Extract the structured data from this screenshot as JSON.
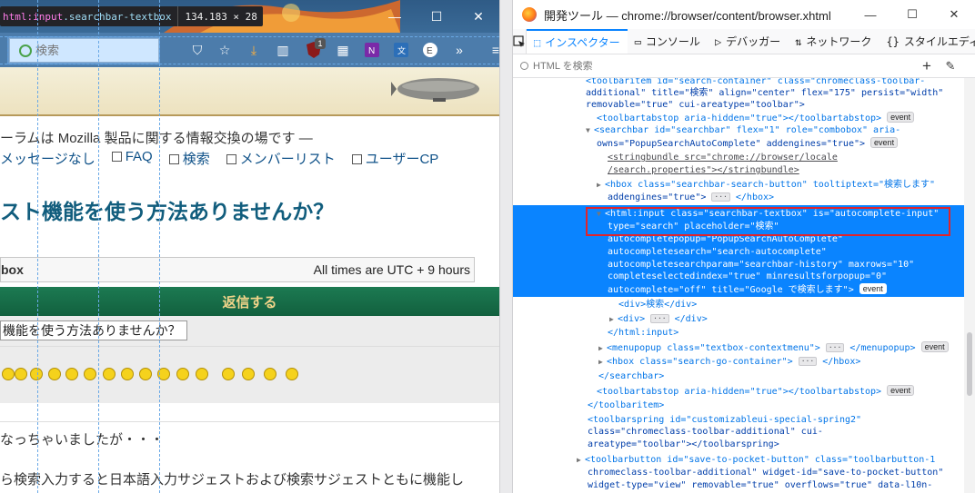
{
  "browser": {
    "picker_tooltip": {
      "tag": "html:input",
      "class_part": ".searchbar-textbox",
      "dimensions": "134.183 × 28"
    },
    "search_placeholder": "検索",
    "toolbar_badge": "1",
    "window_controls": [
      "—",
      "☐",
      "✕"
    ]
  },
  "page": {
    "forum_description": "ーラムは Mozilla 製品に関する情報交換の場です —",
    "nav_links": [
      "メッセージなし",
      "FAQ",
      "検索",
      "メンバーリスト",
      "ユーザーCP"
    ],
    "topic_title": "スト機能を使う方法ありませんか？",
    "tz_left": "box",
    "tz_right": "All times are UTC + 9 hours",
    "reply_heading": "返信する",
    "subject_value": "機能を使う方法ありませんか？",
    "body_line_1": "なっちゃいましたが・・・",
    "body_line_2": "ら検索入力すると日本語入力サジェストおよび検索サジェストともに機能し"
  },
  "devtools": {
    "window_title": "開発ツール — chrome://browser/content/browser.xhtml",
    "tabs": [
      {
        "label": "インスペクター",
        "icon": "inspector-icon"
      },
      {
        "label": "コンソール",
        "icon": "console-icon"
      },
      {
        "label": "デバッガー",
        "icon": "debugger-icon"
      },
      {
        "label": "ネットワーク",
        "icon": "network-icon"
      },
      {
        "label": "スタイルエディター",
        "icon": "style-editor-icon"
      }
    ],
    "search_placeholder": "HTML を検索",
    "event_badge": "event",
    "markup_lines": [
      "<toolbaritem id=\"search-container\" class=\"chromeclass-toolbar-",
      "additional\" title=\"検索\" align=\"center\" flex=\"175\" persist=\"width\"",
      "removable=\"true\" cui-areatype=\"toolbar\">",
      "<toolbartabstop aria-hidden=\"true\"></toolbartabstop>",
      "<searchbar id=\"searchbar\" flex=\"1\" role=\"combobox\" aria-",
      "owns=\"PopupSearchAutoComplete\" addengines=\"true\">",
      "<stringbundle src=\"chrome://browser/locale",
      "/search.properties\"></stringbundle>",
      "<hbox class=\"searchbar-search-button\" tooltiptext=\"検索します\"",
      "addengines=\"true\">",
      "</hbox>",
      "<html:input class=\"searchbar-textbox\" is=\"autocomplete-input\"",
      "type=\"search\" placeholder=\"検索\"",
      "autocompletepopup=\"PopupSearchAutoComplete\"",
      "autocompletesearch=\"search-autocomplete\"",
      "autocompletesearchparam=\"searchbar-history\" maxrows=\"10\"",
      "completeselectedindex=\"true\" minresultsforpopup=\"0\"",
      "autocomplete=\"off\" title=\"Google で検索します\">",
      "<div>検索</div>",
      "<div>",
      "</div>",
      "</html:input>",
      "<menupopup class=\"textbox-contextmenu\">",
      "</menupopup>",
      "<hbox class=\"search-go-container\">",
      "</hbox>",
      "</searchbar>",
      "<toolbartabstop aria-hidden=\"true\"></toolbartabstop>",
      "</toolbaritem>",
      "<toolbarspring id=\"customizableui-special-spring2\"",
      "class=\"chromeclass-toolbar-additional\" cui-",
      "areatype=\"toolbar\"></toolbarspring>",
      "<toolbarbutton id=\"save-to-pocket-button\" class=\"toolbarbutton-1",
      "chromeclass-toolbar-additional\" widget-id=\"save-to-pocket-button\"",
      "widget-type=\"view\" removable=\"true\" overflows=\"true\" data-l10n-"
    ]
  }
}
